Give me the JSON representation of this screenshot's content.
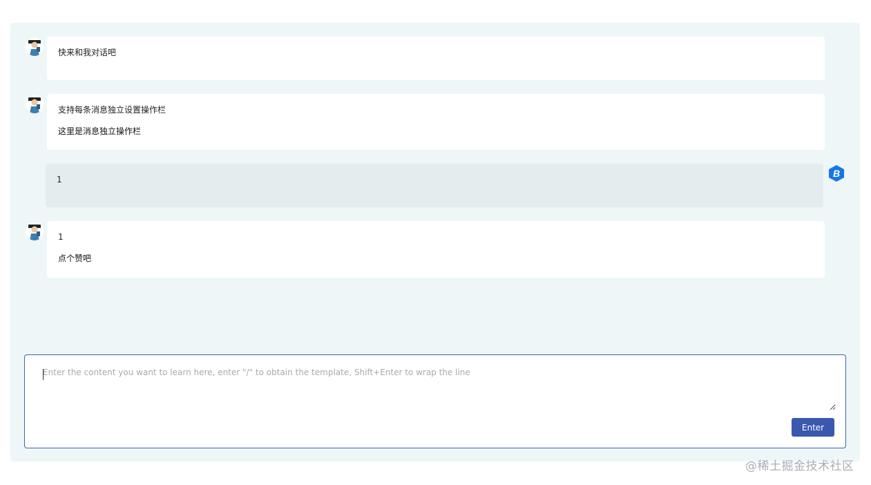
{
  "messages": [
    {
      "role": "assistant",
      "lines": [
        "快来和我对话吧"
      ]
    },
    {
      "role": "assistant",
      "lines": [
        "支持每条消息独立设置操作栏",
        "这里是消息独立操作栏"
      ]
    },
    {
      "role": "user",
      "lines": [
        "1"
      ]
    },
    {
      "role": "assistant",
      "lines": [
        "1",
        "点个赞吧"
      ]
    }
  ],
  "composer": {
    "placeholder": "Enter the content you want to learn here, enter \"/\" to obtain the template, Shift+Enter to wrap the line",
    "value": "",
    "enter_label": "Enter"
  },
  "watermark": "@稀土掘金技术社区",
  "icons": {
    "assistant_avatar": "person-avatar-icon",
    "user_avatar": "b-hexagon-logo-icon"
  },
  "colors": {
    "panel_bg": "#eef6f8",
    "user_bubble": "#e4edee",
    "accent": "#3a58ae",
    "composer_border": "#3b63a6",
    "logo_blue": "#1677e5"
  }
}
